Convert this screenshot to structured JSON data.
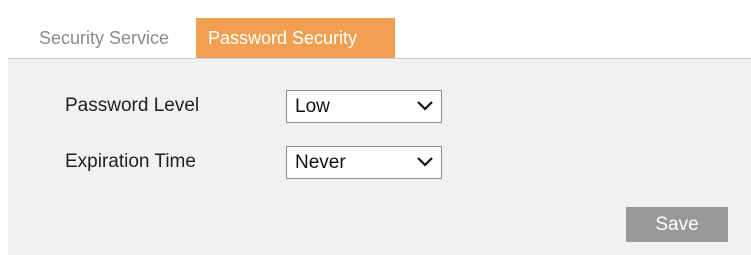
{
  "tabs": [
    {
      "label": "Security Service",
      "active": false
    },
    {
      "label": "Password Security",
      "active": true
    }
  ],
  "colors": {
    "active_tab": "#f0a050",
    "panel_bg": "#f1f1f1",
    "save_button": "#999999"
  },
  "fields": {
    "password_level": {
      "label": "Password Level",
      "value": "Low",
      "icon": "chevron-down-icon"
    },
    "expiration_time": {
      "label": "Expiration Time",
      "value": "Never",
      "icon": "chevron-down-icon"
    }
  },
  "actions": {
    "save_label": "Save"
  }
}
